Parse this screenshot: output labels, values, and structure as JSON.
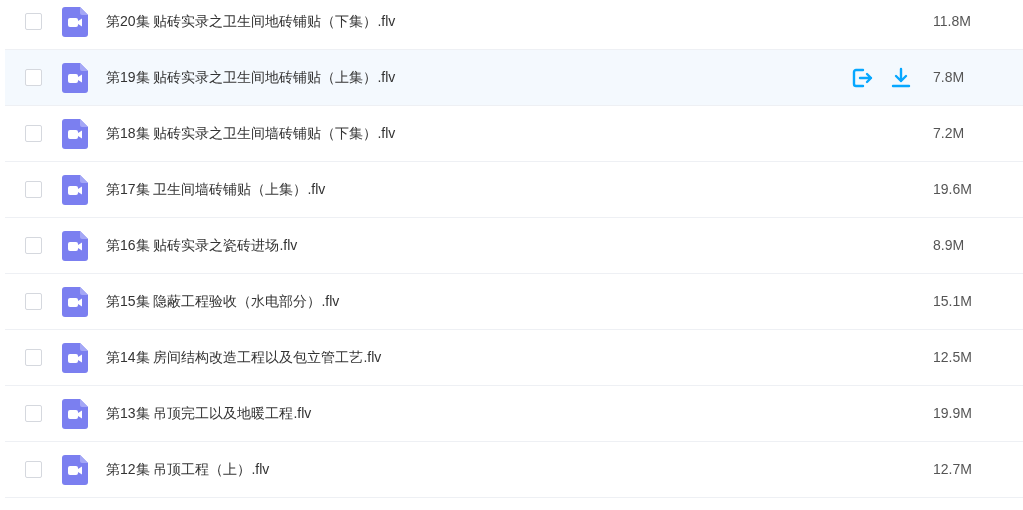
{
  "files": [
    {
      "name": "第20集 贴砖实录之卫生间地砖铺贴（下集）.flv",
      "size": "11.8M",
      "checked": false,
      "highlighted": false
    },
    {
      "name": "第19集 贴砖实录之卫生间地砖铺贴（上集）.flv",
      "size": "7.8M",
      "checked": false,
      "highlighted": true
    },
    {
      "name": "第18集 贴砖实录之卫生间墙砖铺贴（下集）.flv",
      "size": "7.2M",
      "checked": false,
      "highlighted": false
    },
    {
      "name": "第17集 卫生间墙砖铺贴（上集）.flv",
      "size": "19.6M",
      "checked": false,
      "highlighted": false
    },
    {
      "name": "第16集 贴砖实录之瓷砖进场.flv",
      "size": "8.9M",
      "checked": false,
      "highlighted": false
    },
    {
      "name": "第15集 隐蔽工程验收（水电部分）.flv",
      "size": "15.1M",
      "checked": false,
      "highlighted": false
    },
    {
      "name": "第14集 房间结构改造工程以及包立管工艺.flv",
      "size": "12.5M",
      "checked": false,
      "highlighted": false
    },
    {
      "name": "第13集 吊顶完工以及地暖工程.flv",
      "size": "19.9M",
      "checked": false,
      "highlighted": false
    },
    {
      "name": "第12集 吊顶工程（上）.flv",
      "size": "12.7M",
      "checked": false,
      "highlighted": false
    }
  ]
}
